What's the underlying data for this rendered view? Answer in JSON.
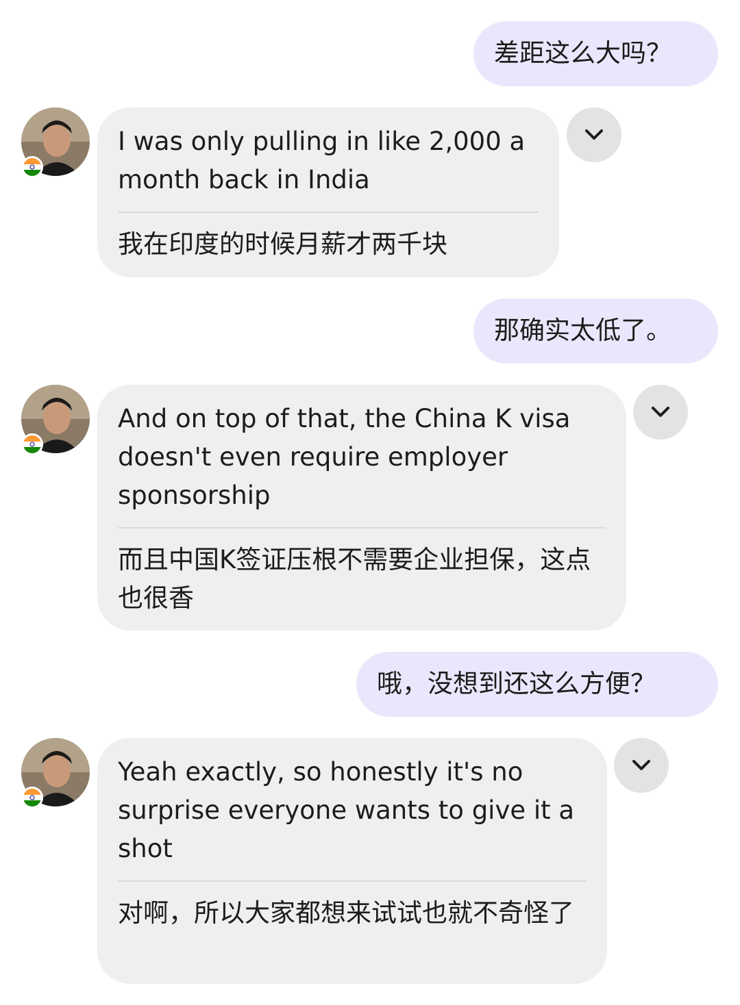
{
  "messages": [
    {
      "from": "me",
      "text": "差距这么大吗？"
    },
    {
      "from": "contact",
      "original": "I was only pulling in like 2,000 a month back in India",
      "translation": "我在印度的时候月薪才两千块"
    },
    {
      "from": "me",
      "text": "那确实太低了。"
    },
    {
      "from": "contact",
      "original": "And on top of that, the China K visa doesn't even require employer sponsorship",
      "translation": "而且中国K签证压根不需要企业担保，这点也很香"
    },
    {
      "from": "me",
      "text": "哦，没想到还这么方便？"
    },
    {
      "from": "contact",
      "original": "Yeah exactly, so honestly it's no surprise everyone wants to give it a shot",
      "translation": "对啊，所以大家都想来试试也就不奇怪了"
    }
  ],
  "contact": {
    "avatar_icon": "profile-photo-icon",
    "badge_icon": "india-flag-icon"
  },
  "message_menu_icon": "chevron-down-icon",
  "colors": {
    "sent_bubble": "#e9e7fb",
    "received_bubble": "#efefef",
    "menu_button": "#e3e3e3",
    "text": "#1c1c1c"
  }
}
